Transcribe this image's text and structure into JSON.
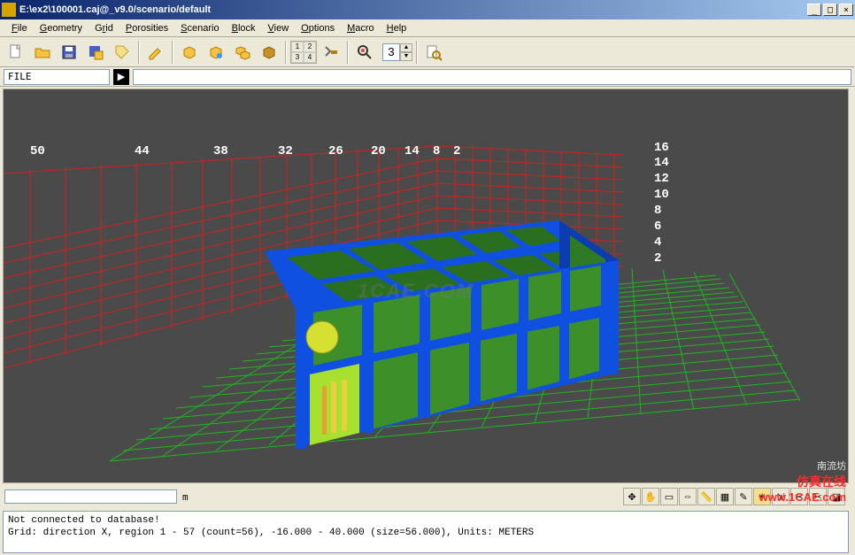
{
  "window": {
    "title": "E:\\ex2\\100001.caj@_v9.0/scenario/default"
  },
  "menu": {
    "items": [
      {
        "label": "File",
        "u": "F"
      },
      {
        "label": "Geometry",
        "u": "G"
      },
      {
        "label": "Grid",
        "u": "r",
        "pre": "G"
      },
      {
        "label": "Porosities",
        "u": "P"
      },
      {
        "label": "Scenario",
        "u": "S"
      },
      {
        "label": "Block",
        "u": "B"
      },
      {
        "label": "View",
        "u": "V"
      },
      {
        "label": "Options",
        "u": "O"
      },
      {
        "label": "Macro",
        "u": "M"
      },
      {
        "label": "Help",
        "u": "H"
      }
    ]
  },
  "toolbar": {
    "icons": [
      "new-file",
      "open-folder",
      "save",
      "save-report",
      "tag",
      "pencil",
      "cube-yellow",
      "cube-blue",
      "cube-stack",
      "cube-dark",
      "grid-1234",
      "hammer",
      "zoom-color",
      "spinner-3",
      "zoom-page"
    ],
    "spinner_value": "3"
  },
  "command_bar": {
    "label": "FILE",
    "go_icon": "▶",
    "input_value": ""
  },
  "viewport": {
    "x_ticks": [
      "50",
      "44",
      "38",
      "32",
      "26",
      "20",
      "14",
      "8",
      "2"
    ],
    "z_ticks": [
      "16",
      "14",
      "12",
      "10",
      "8",
      "6",
      "4",
      "2"
    ],
    "center_watermark": "1CAE.COM"
  },
  "ruler": {
    "unit_label": "m"
  },
  "right_tools": [
    "arrows",
    "hand",
    "box-select",
    "dist",
    "ruler",
    "grid",
    "pencil",
    "sun",
    "ax",
    "scissors",
    "x2",
    "plane"
  ],
  "status": {
    "line1": "Not connected to database!",
    "line2": "",
    "line3": "Grid: direction X, region 1 - 57 (count=56), -16.000 - 40.000 (size=56.000), Units: METERS"
  },
  "watermarks": {
    "brand1": "南流坊",
    "brand2": "仿真在线",
    "url": "www.1CAE.com"
  }
}
